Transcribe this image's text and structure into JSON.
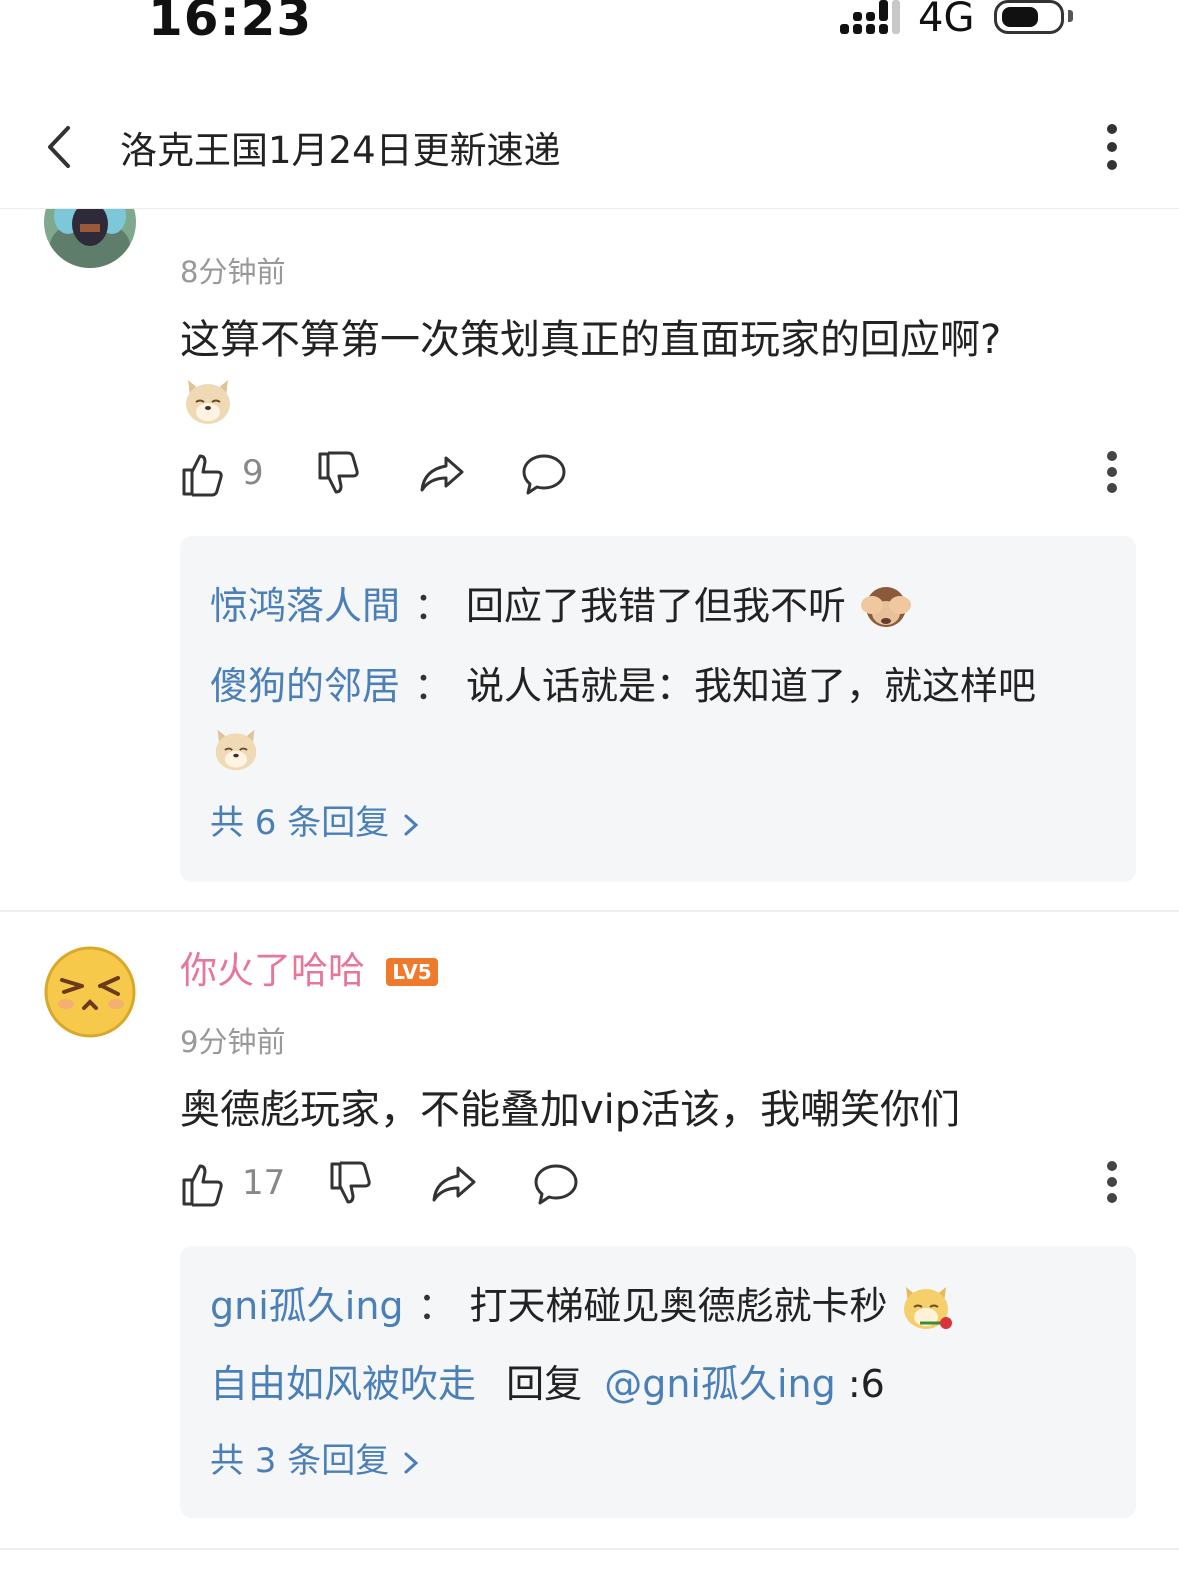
{
  "status_bar": {
    "time": "16:23",
    "network": "4G",
    "battery_level": 0.6
  },
  "header": {
    "title": "洛克王国1月24日更新速递",
    "back_icon": "chevron-left-icon",
    "more_icon": "more-vertical-icon"
  },
  "comments": [
    {
      "timestamp": "8分钟前",
      "text": "这算不算第一次策划真正的直面玩家的回应啊?",
      "trailing_emoji": "doge-face-icon",
      "like_count": "9",
      "replies": [
        {
          "user": "惊鸿落人間",
          "sep": "：",
          "text": "回应了我错了但我不听",
          "emoji": "see-no-evil-monkey-icon"
        },
        {
          "user": "傻狗的邻居",
          "sep": "：",
          "text": "说人话就是：我知道了，就这样吧",
          "emoji": "doge-face-icon"
        }
      ],
      "reply_total": "共 6 条回复"
    },
    {
      "username": "你火了哈哈",
      "level_badge": "LV5",
      "username_color": "#e8769a",
      "timestamp": "9分钟前",
      "text": "奥德彪玩家，不能叠加vip活该，我嘲笑你们",
      "like_count": "17",
      "replies": [
        {
          "user": "gni孤久ing",
          "sep": "：",
          "text": "打天梯碰见奥德彪就卡秒",
          "emoji": "doge-rose-icon"
        },
        {
          "user": "自由如风被吹走",
          "reply_word": "回复",
          "reply_to": "@gni孤久ing",
          "text": ":6"
        }
      ],
      "reply_total": "共 3 条回复"
    }
  ],
  "colors": {
    "link_blue": "#4a7fb8",
    "badge_orange": "#f07a2b",
    "reply_bg": "#f5f6f8"
  }
}
